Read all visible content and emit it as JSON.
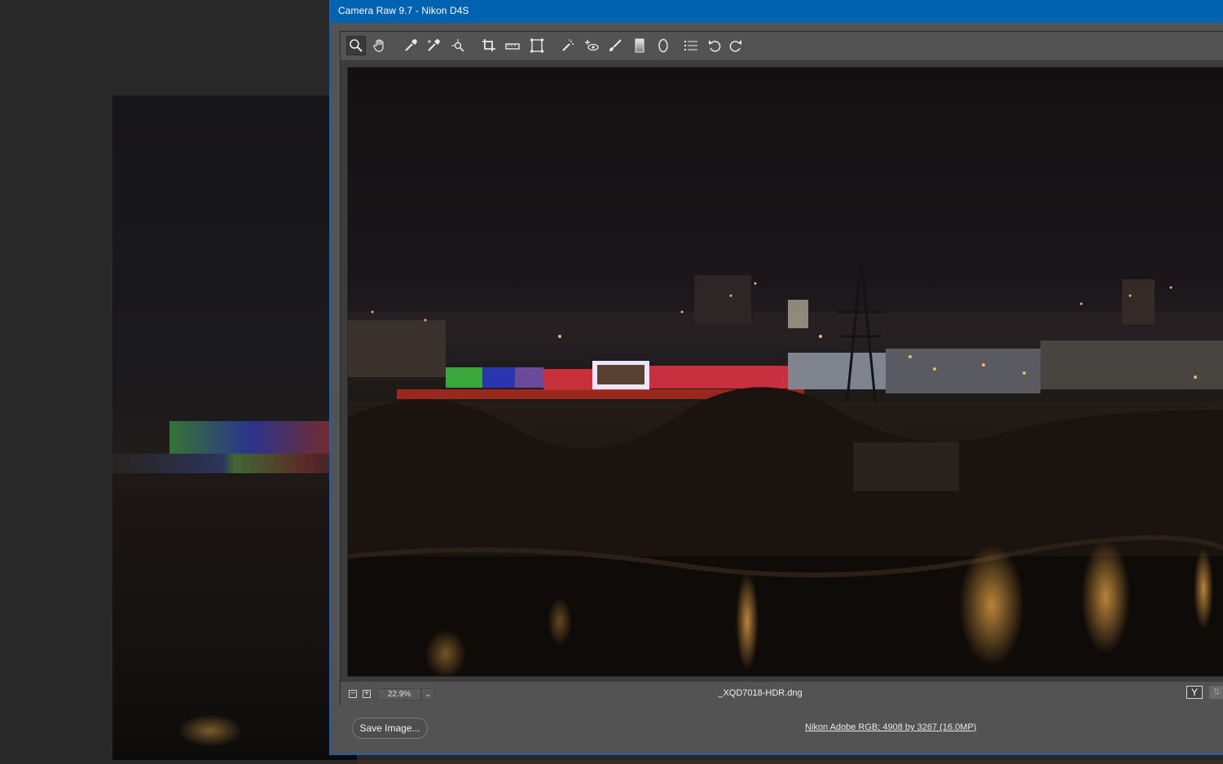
{
  "window": {
    "title": "Camera Raw 9.7  -  Nikon D4S"
  },
  "toolbar": {
    "tools": [
      {
        "name": "zoom-tool-icon",
        "glyph": "🔍"
      },
      {
        "name": "hand-tool-icon",
        "glyph": "✋"
      },
      {
        "name": "white-balance-tool-icon",
        "glyph": "✎"
      },
      {
        "name": "color-sampler-tool-icon",
        "glyph": "✑"
      },
      {
        "name": "targeted-adjustment-tool-icon",
        "glyph": "⌖"
      },
      {
        "name": "crop-tool-icon",
        "glyph": "⌗"
      },
      {
        "name": "straighten-tool-icon",
        "glyph": "▭"
      },
      {
        "name": "transform-tool-icon",
        "glyph": "⧈"
      },
      {
        "name": "spot-removal-tool-icon",
        "glyph": "✧"
      },
      {
        "name": "red-eye-tool-icon",
        "glyph": "+◉"
      },
      {
        "name": "adjustment-brush-icon",
        "glyph": "🖌"
      },
      {
        "name": "graduated-filter-icon",
        "glyph": "▮"
      },
      {
        "name": "radial-filter-icon",
        "glyph": "◯"
      },
      {
        "name": "preferences-icon",
        "glyph": "☰"
      },
      {
        "name": "rotate-ccw-icon",
        "glyph": "↺"
      },
      {
        "name": "rotate-cw-icon",
        "glyph": "↻"
      }
    ]
  },
  "status": {
    "zoom_out": "−",
    "zoom_in": "+",
    "zoom_value": "22.9%",
    "zoom_dropdown": "⌄",
    "filename": "_XQD7018-HDR.dng",
    "before_after_toggle": "Y",
    "sync": "⇅"
  },
  "footer": {
    "save_label": "Save Image...",
    "workflow_options": "Nikon Adobe RGB; 4908 by 3267 (16.0MP)"
  },
  "colors": {
    "titlebar": "#0063b1",
    "panel": "#535353",
    "background": "#282828"
  }
}
